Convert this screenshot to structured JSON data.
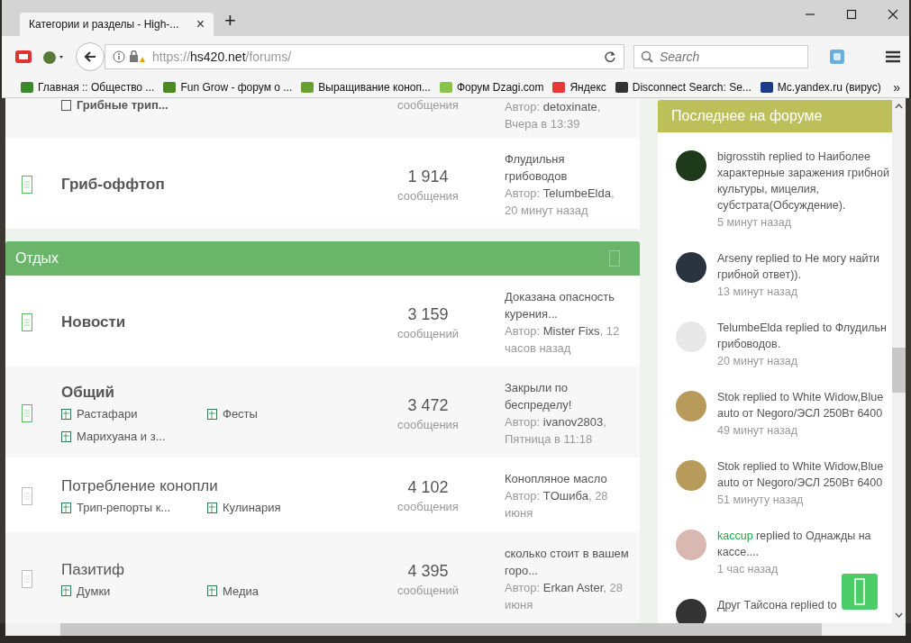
{
  "browser": {
    "tab_title": "Категории и разделы - High-...",
    "tab_close": "×",
    "new_tab": "+",
    "url_scheme": "https://",
    "url_host": "hs420.net",
    "url_path": "/forums/",
    "search": {
      "placeholder": "Search"
    },
    "bookmarks": [
      {
        "label": "Главная :: Общество ...",
        "color": "#3a8a2a"
      },
      {
        "label": "Fun Grow - форум о ...",
        "color": "#4a8a20"
      },
      {
        "label": "Выращивание коноп...",
        "color": "#6aa030"
      },
      {
        "label": "Форум Dzagi.com",
        "color": "#8bc34a"
      },
      {
        "label": "Яндекс",
        "color": "#e53935"
      },
      {
        "label": "Disconnect Search: Se...",
        "color": "#333333"
      },
      {
        "label": "Mc.yandex.ru (вирус)",
        "color": "#1a3a8a"
      }
    ],
    "more": "»"
  },
  "forums": {
    "top_partial": {
      "subforum": "Грибные трип...",
      "stat_label": "сообщения",
      "author_label": "Автор:",
      "author": "detoxinate",
      "time": ", Вчера в 13:39"
    },
    "rows_before": [
      {
        "title": "Гриб-оффтоп",
        "unread": true,
        "count": "1 914",
        "count_label": "сообщения",
        "last_title": "Флудильня грибоводов",
        "author_label": "Автор:",
        "author": "TelumbeElda",
        "time": ", 20 минут назад"
      }
    ],
    "category": {
      "title": "Отдых"
    },
    "rows": [
      {
        "title": "Новости",
        "unread": true,
        "count": "3 159",
        "count_label": "сообщений",
        "last_title": "Доказана опасность курения...",
        "author_label": "Автор:",
        "author": "Mister Fixs",
        "time": ", 12 часов назад"
      },
      {
        "title": "Общий",
        "unread": true,
        "count": "3 472",
        "count_label": "сообщения",
        "last_title": "Закрыли по беспределу!",
        "author_label": "Автор:",
        "author": "ivanov2803",
        "time": ", Пятница в 11:18",
        "subforums": [
          "Растафари",
          "Фесты",
          "Марихуана и з..."
        ]
      },
      {
        "title": "Потребление конопли",
        "unread": false,
        "count": "4 102",
        "count_label": "сообщения",
        "last_title": "Конопляное масло",
        "author_label": "Автор:",
        "author": "TОшиба",
        "time": ", 28 июня",
        "subforums": [
          "Трип-репорты к...",
          "Кулинария"
        ]
      },
      {
        "title": "Пазитиф",
        "unread": false,
        "count": "4 395",
        "count_label": "сообщений",
        "last_title": "сколько стоит в вашем горо...",
        "author_label": "Автор:",
        "author": "Erkan Aster",
        "time": ", 28 июня",
        "subforums": [
          "Думки",
          "Медиа"
        ]
      }
    ]
  },
  "sidebar": {
    "title": "Последнее на форуме",
    "items": [
      {
        "user": "bigrosstih",
        "highlight": false,
        "text": "replied to Наиболее характерные заражения грибной культуры, мицелия, субстрата(Обсуждение).",
        "time": "5 минут назад",
        "color": "#1f3a1a"
      },
      {
        "user": "Arseny",
        "highlight": false,
        "text": "replied to Не могу найти грибной ответ)).",
        "time": "13 минут назад",
        "color": "#2a3440"
      },
      {
        "user": "TelumbeElda",
        "highlight": false,
        "text": "replied to Флудильн грибоводов.",
        "time": "20 минут назад",
        "color": "#e8e8e8"
      },
      {
        "user": "Stok",
        "highlight": false,
        "text": "replied to White Widow,Blue auto от Negoro/ЭСЛ 250Вт 6400",
        "time": "49 минут назад",
        "color": "#b89a5a"
      },
      {
        "user": "Stok",
        "highlight": false,
        "text": "replied to White Widow,Blue auto от Negoro/ЭСЛ 250Вт 6400",
        "time": "51 минуту назад",
        "color": "#b89a5a"
      },
      {
        "user": "kaccup",
        "highlight": true,
        "text": "replied to Однажды на кассе....",
        "time": "1 час назад",
        "color": "#d8b8b0"
      },
      {
        "user": "Друг Тайсона",
        "highlight": false,
        "text": "replied to",
        "color": "#333333"
      }
    ]
  }
}
